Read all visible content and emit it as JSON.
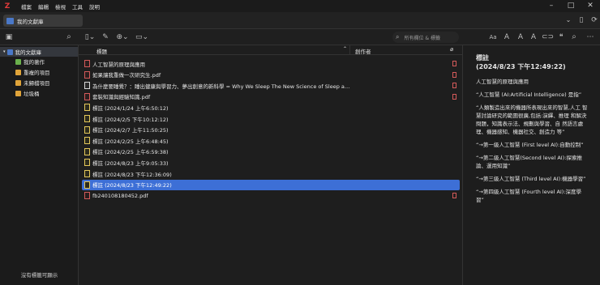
{
  "menu": {
    "logo": "Z",
    "items": [
      "檔案",
      "編輯",
      "檢視",
      "工具",
      "說明"
    ]
  },
  "tab": {
    "label": "我的文獻庫"
  },
  "search": {
    "placeholder": "所有欄位 & 標籤"
  },
  "sidebar": {
    "items": [
      {
        "label": "我的文獻庫",
        "icon": "library-icon",
        "color": "#4a78c8"
      },
      {
        "label": "我的著作",
        "icon": "my-publications-icon",
        "color": "#6ab04c"
      },
      {
        "label": "重複的項目",
        "icon": "duplicates-icon",
        "color": "#e0a43a"
      },
      {
        "label": "未歸檔項目",
        "icon": "unfiled-icon",
        "color": "#e0a43a"
      },
      {
        "label": "垃圾桶",
        "icon": "trash-icon",
        "color": "#e0a43a"
      }
    ],
    "no_tags": "沒有標籤可顯示"
  },
  "columns": {
    "title": "標題",
    "creator": "創作者"
  },
  "rows": [
    {
      "title": "人工智慧的原理與應用",
      "type": "pdf",
      "attach": true
    },
    {
      "title": "如果讓我重做一次研究生.pdf",
      "type": "pdf",
      "attach": true
    },
    {
      "title": "為什麼要睡覺？：睡出健康與學習力、夢出創意的新科學 = Why We Sleep The New Science of Sleep and Dr...",
      "type": "web",
      "attach": true
    },
    {
      "title": "套裝知識與經驗知識.pdf",
      "type": "pdf",
      "attach": true
    },
    {
      "title": "標註 (2024/1/24 上午6:50:12)",
      "type": "note",
      "attach": false
    },
    {
      "title": "標註 (2024/2/5 下午10:12:12)",
      "type": "note",
      "attach": false
    },
    {
      "title": "標註 (2024/2/7 上午11:50:25)",
      "type": "note",
      "attach": false
    },
    {
      "title": "標註 (2024/2/25 上午6:48:45)",
      "type": "note",
      "attach": false
    },
    {
      "title": "標註 (2024/2/25 上午6:59:38)",
      "type": "note",
      "attach": false
    },
    {
      "title": "標註 (2024/8/23 上午9:05:33)",
      "type": "note",
      "attach": false
    },
    {
      "title": "標註 (2024/8/23 下午12:36:09)",
      "type": "note",
      "attach": false
    },
    {
      "title": "標註 (2024/8/23 下午12:49:22)",
      "type": "note",
      "attach": false,
      "selected": true
    },
    {
      "title": "fb240108180452.pdf",
      "type": "pdf",
      "attach": true
    }
  ],
  "note": {
    "heading1": "標註",
    "heading2": "(2024/8/23 下午12:49:22)",
    "paragraphs": [
      "人工智慧的原理與應用",
      "“人工智慧 (AI:Artificial Intelligence) 是指”",
      "“人類製造出來的機器所表現出來的智慧,人工 智慧討論研究的範圍很廣,包括:演繹、推理 和解決問題，知識表示法、規劃與學習、自 然語言處理、機器感知、機器社交、創造力 等”",
      "“→第一級人工智慧 (First level AI):自動控制”",
      "“→第二級人工智慧(Second level AI):探索推論、運用知識”",
      "“→第三級人工智慧 (Third level AI):機器學習”",
      "“→第四級人工智慧 (Fourth level AI):深度學習”"
    ]
  },
  "colors": {
    "accent": "#3d6fd6",
    "pdf": "#d45a5a",
    "note": "#e4c85a"
  }
}
